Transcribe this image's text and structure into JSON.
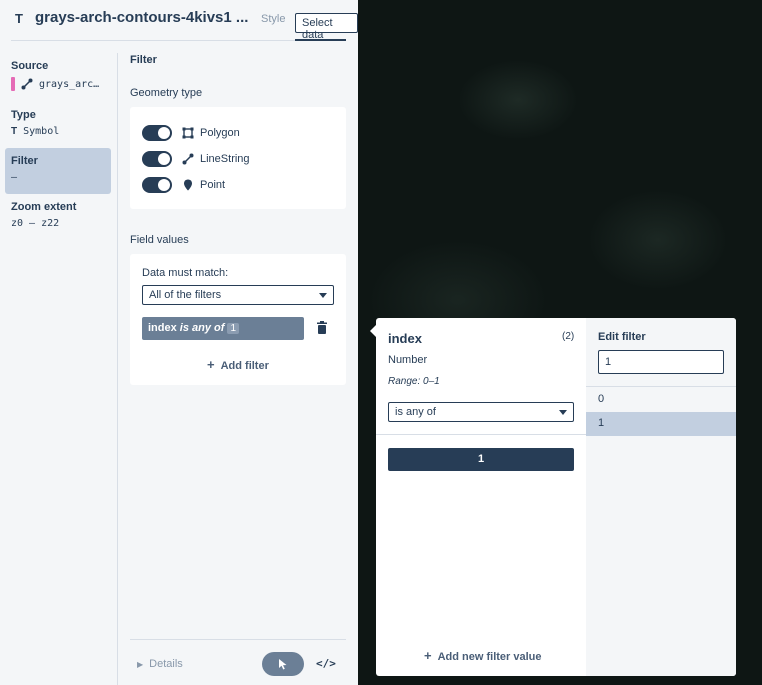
{
  "header": {
    "type_icon": "T",
    "title": "grays-arch-contours-4kivs1 ...",
    "tabs": [
      "Style",
      "Select data"
    ]
  },
  "side": {
    "source_label": "Source",
    "source_value": "grays_arc…",
    "type_label": "Type",
    "type_icon": "T",
    "type_value": "Symbol",
    "filter_label": "Filter",
    "filter_value": "–",
    "zoom_label": "Zoom extent",
    "zoom_value": "z0 – z22"
  },
  "filter": {
    "heading": "Filter",
    "geometry_heading": "Geometry type",
    "geometry": [
      {
        "label": "Polygon",
        "icon": "polygon-icon",
        "on": true
      },
      {
        "label": "LineString",
        "icon": "linestring-icon",
        "on": true
      },
      {
        "label": "Point",
        "icon": "point-icon",
        "on": true
      }
    ],
    "field_heading": "Field values",
    "match_label": "Data must match:",
    "match_value": "All of the filters",
    "chip_field": "index",
    "chip_op": "is any of",
    "chip_value": "1",
    "add_filter": "Add filter"
  },
  "footer": {
    "details": "Details",
    "code": "</>"
  },
  "popover": {
    "field": "index",
    "count": "(2)",
    "type": "Number",
    "range": "Range: 0–1",
    "operator": "is any of",
    "selected_value": "1",
    "add_value": "Add new filter value",
    "edit_heading": "Edit filter",
    "edit_input": "1",
    "options": [
      "0",
      "1"
    ]
  },
  "colors": {
    "accent": "#273d56",
    "source_swatch": "#e56bb6",
    "selection": "#c2cfe0"
  }
}
